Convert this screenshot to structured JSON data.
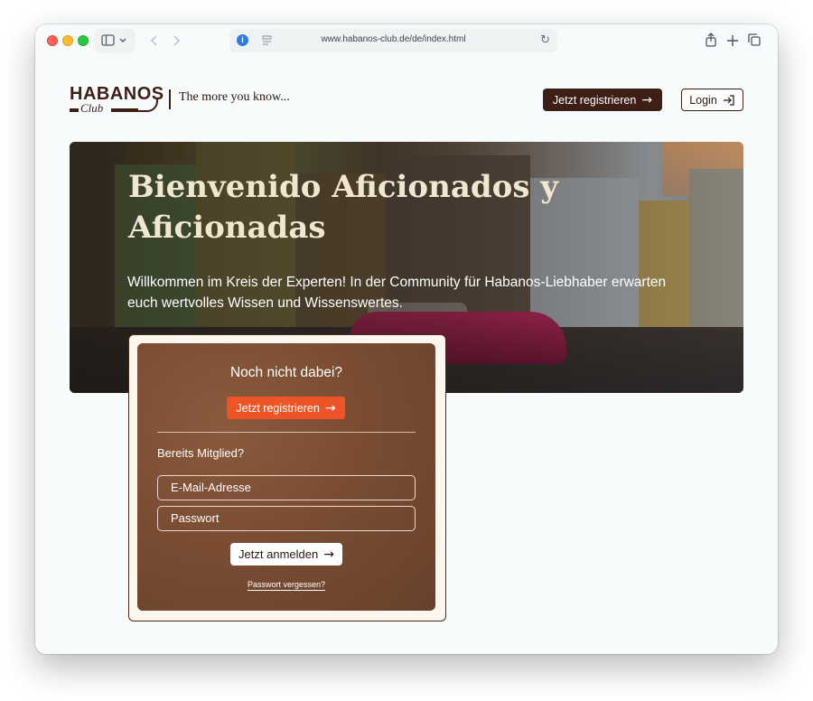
{
  "browser": {
    "url": "www.habanos-club.de/de/index.html"
  },
  "header": {
    "logo_word": "HABANOS",
    "logo_sub": "Club",
    "tagline": "The more you know...",
    "register_label": "Jetzt registrieren",
    "login_label": "Login"
  },
  "hero": {
    "title": "Bienvenido Aficionados y Aficionadas",
    "subtitle": "Willkommen im Kreis der Experten! In der Community für Habanos-Liebhaber erwarten euch wertvolles Wissen und Wissenswertes."
  },
  "login_card": {
    "heading": "Noch nicht dabei?",
    "register_label": "Jetzt registrieren",
    "member_label": "Bereits Mitglied?",
    "email_placeholder": "E-Mail-Adresse",
    "password_placeholder": "Passwort",
    "signin_label": "Jetzt anmelden",
    "forgot_label": "Passwort vergessen?"
  },
  "colors": {
    "brand_brown": "#3d1f16",
    "accent_orange": "#ee5526"
  }
}
